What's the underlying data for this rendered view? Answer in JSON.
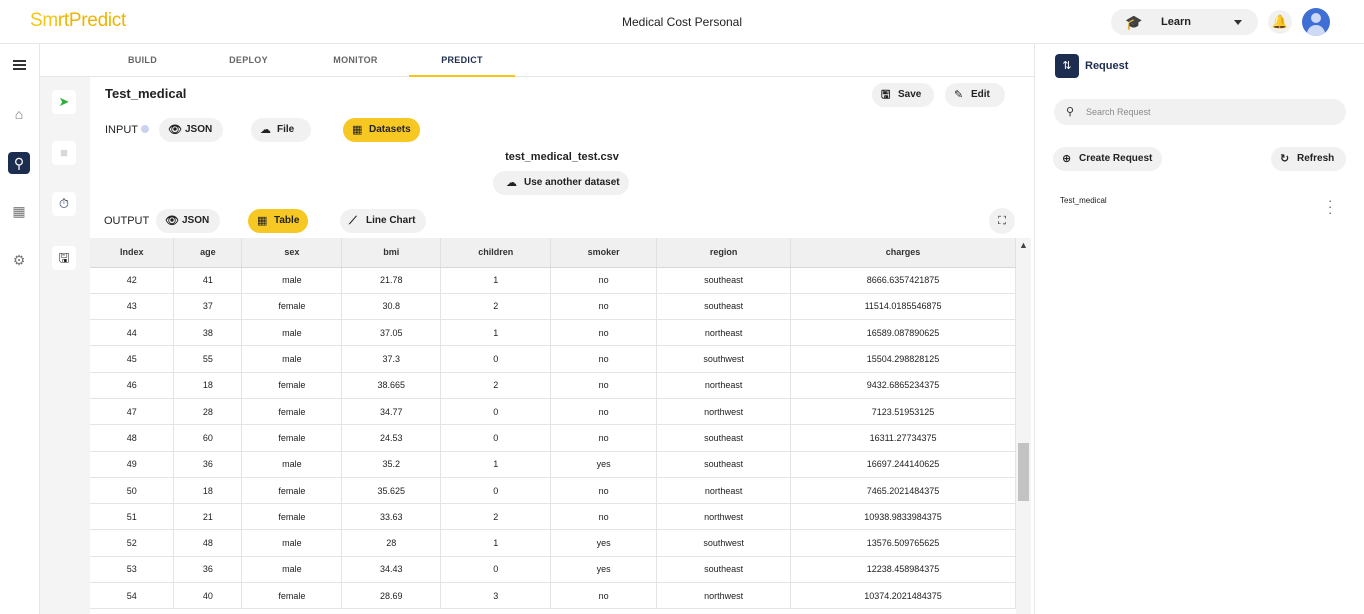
{
  "app": {
    "logo_part1": "Sm",
    "logo_part2": "rtPredict",
    "title": "Medical Cost Personal",
    "learn_label": "Learn"
  },
  "tabs": [
    {
      "label": "BUILD",
      "active": false
    },
    {
      "label": "DEPLOY",
      "active": false
    },
    {
      "label": "MONITOR",
      "active": false
    },
    {
      "label": "PREDICT",
      "active": true
    }
  ],
  "request": {
    "name": "Test_medical",
    "save_label": "Save",
    "edit_label": "Edit"
  },
  "input": {
    "label": "INPUT",
    "json_label": "JSON",
    "file_label": "File",
    "datasets_label": "Datasets",
    "filename": "test_medical_test.csv",
    "another_dataset_label": "Use another dataset"
  },
  "output": {
    "label": "OUTPUT",
    "json_label": "JSON",
    "table_label": "Table",
    "line_chart_label": "Line Chart"
  },
  "table": {
    "columns": [
      "Index",
      "age",
      "sex",
      "bmi",
      "children",
      "smoker",
      "region",
      "charges"
    ],
    "rows": [
      [
        "42",
        "41",
        "male",
        "21.78",
        "1",
        "no",
        "southeast",
        "8666.6357421875"
      ],
      [
        "43",
        "37",
        "female",
        "30.8",
        "2",
        "no",
        "southeast",
        "11514.0185546875"
      ],
      [
        "44",
        "38",
        "male",
        "37.05",
        "1",
        "no",
        "northeast",
        "16589.087890625"
      ],
      [
        "45",
        "55",
        "male",
        "37.3",
        "0",
        "no",
        "southwest",
        "15504.298828125"
      ],
      [
        "46",
        "18",
        "female",
        "38.665",
        "2",
        "no",
        "northeast",
        "9432.6865234375"
      ],
      [
        "47",
        "28",
        "female",
        "34.77",
        "0",
        "no",
        "northwest",
        "7123.51953125"
      ],
      [
        "48",
        "60",
        "female",
        "24.53",
        "0",
        "no",
        "southeast",
        "16311.27734375"
      ],
      [
        "49",
        "36",
        "male",
        "35.2",
        "1",
        "yes",
        "southeast",
        "16697.244140625"
      ],
      [
        "50",
        "18",
        "female",
        "35.625",
        "0",
        "no",
        "northeast",
        "7465.2021484375"
      ],
      [
        "51",
        "21",
        "female",
        "33.63",
        "2",
        "no",
        "northwest",
        "10938.9833984375"
      ],
      [
        "52",
        "48",
        "male",
        "28",
        "1",
        "yes",
        "southwest",
        "13576.509765625"
      ],
      [
        "53",
        "36",
        "male",
        "34.43",
        "0",
        "yes",
        "southeast",
        "12238.458984375"
      ],
      [
        "54",
        "40",
        "female",
        "28.69",
        "3",
        "no",
        "northwest",
        "10374.2021484375"
      ]
    ]
  },
  "right_panel": {
    "title": "Request",
    "search_placeholder": "Search Request",
    "create_label": "Create Request",
    "refresh_label": "Refresh",
    "items": [
      "Test_medical"
    ]
  },
  "colors": {
    "accent_yellow": "#f7c823",
    "navy": "#1d2d4f"
  }
}
